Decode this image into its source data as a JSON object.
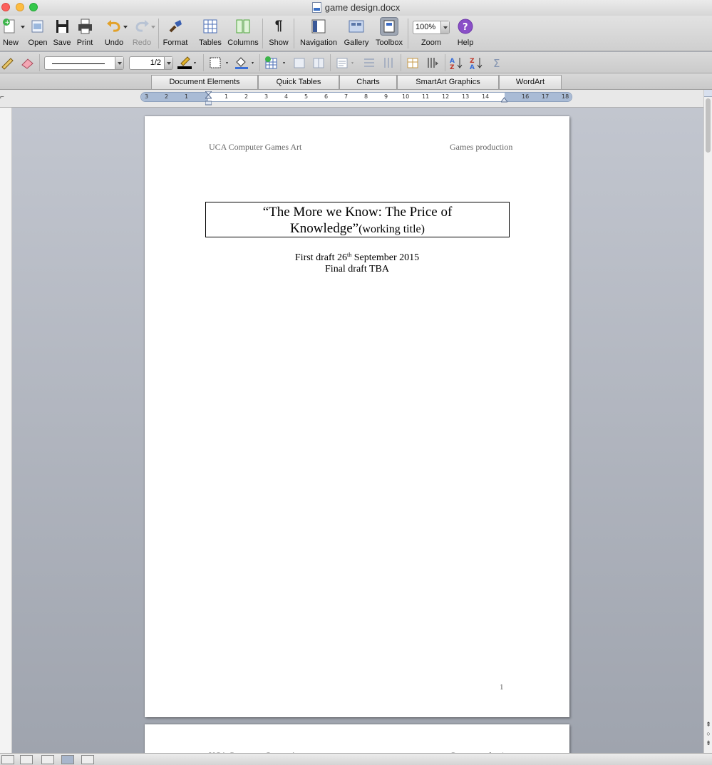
{
  "window": {
    "title": "game design.docx"
  },
  "toolbar": {
    "new": "New",
    "open": "Open",
    "save": "Save",
    "print": "Print",
    "undo": "Undo",
    "redo": "Redo",
    "format": "Format",
    "tables": "Tables",
    "columns": "Columns",
    "show": "Show",
    "navigation": "Navigation",
    "gallery": "Gallery",
    "toolbox": "Toolbox",
    "zoom": "Zoom",
    "help": "Help",
    "zoom_value": "100%"
  },
  "formatting": {
    "line_weight": "1/2"
  },
  "ribbon": {
    "tabs": [
      "Document Elements",
      "Quick Tables",
      "Charts",
      "SmartArt Graphics",
      "WordArt"
    ]
  },
  "ruler": {
    "ticks": [
      "3",
      "2",
      "1",
      "1",
      "2",
      "3",
      "4",
      "5",
      "6",
      "7",
      "8",
      "9",
      "10",
      "11",
      "12",
      "13",
      "14",
      "16",
      "17",
      "18"
    ]
  },
  "document": {
    "header_left": "UCA Computer Games Art",
    "header_right": "Games production",
    "title_line1": "“The More we Know: The Price of",
    "title_line2": "Knowledge”",
    "title_suffix": "(working title)",
    "first_draft_prefix": "First draft 26",
    "first_draft_sup": "th",
    "first_draft_suffix": " September 2015",
    "final_draft": "Final draft TBA",
    "page_number": "1"
  },
  "colors": {
    "help_purple": "#8a4fc7",
    "ruler_blue": "#a9bbd5",
    "undo_orange": "#e2a129"
  }
}
